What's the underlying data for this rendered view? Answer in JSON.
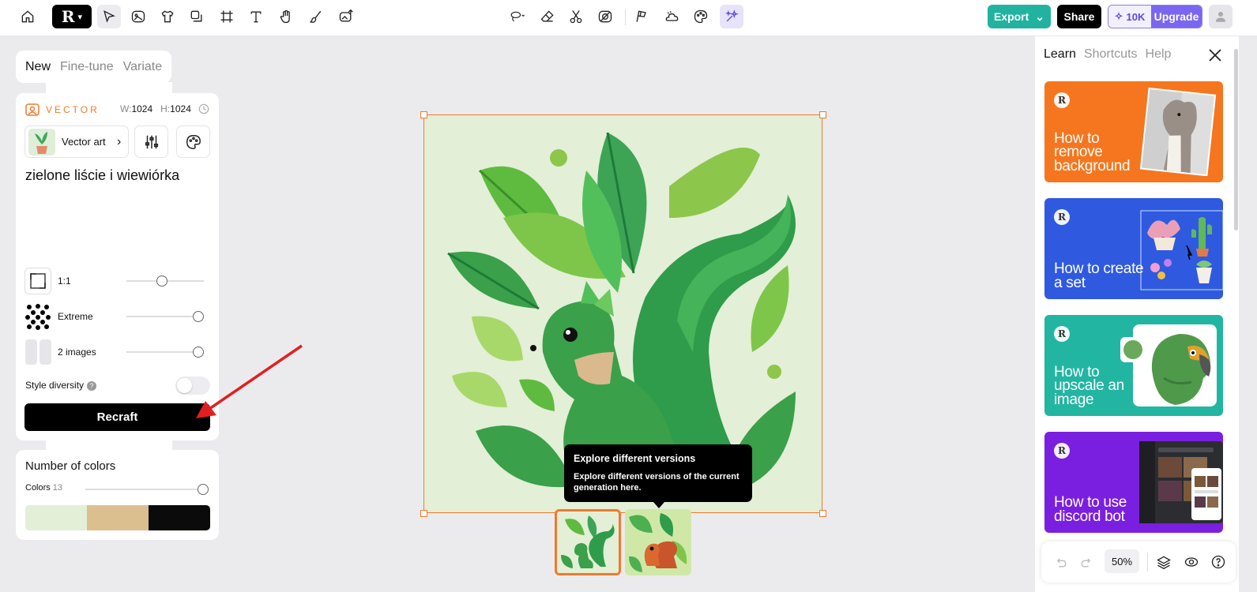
{
  "toolbar": {
    "tools": [
      "home-icon",
      "logo-menu",
      "select-icon",
      "image-generate-icon",
      "mockup-icon",
      "layers-copy-icon",
      "frame-icon",
      "text-icon",
      "hand-icon",
      "brush-icon",
      "image-upload-icon"
    ],
    "center_tools": [
      "lasso-icon",
      "eraser-icon",
      "scissors-icon",
      "vectorize-icon",
      "flags-icon",
      "cloud-icon",
      "palette-icon",
      "magic-sparkle-icon"
    ],
    "export_label": "Export",
    "share_label": "Share",
    "credits": "10K",
    "upgrade_label": "Upgrade"
  },
  "left": {
    "tabs": [
      {
        "label": "New",
        "active": true
      },
      {
        "label": "Fine-tune",
        "active": false
      },
      {
        "label": "Variate",
        "active": false
      }
    ],
    "vector_label": "VECTOR",
    "width_label": "W:",
    "width": "1024",
    "height_label": "H:",
    "height": "1024",
    "style_name": "Vector art",
    "prompt": "zielone liście i wiewiórka",
    "settings": [
      {
        "label": "1:1",
        "value": 0.45
      },
      {
        "label": "Extreme",
        "value": 0.92
      },
      {
        "label": "2 images",
        "value": 0.92
      }
    ],
    "style_diversity_label": "Style diversity",
    "style_diversity_on": false,
    "recraft_label": "Recraft",
    "colors": {
      "title": "Number of colors",
      "label": "Colors",
      "count": "13",
      "palette": [
        "#e3efd6",
        "#dcbf8f",
        "#0b0b0b"
      ]
    }
  },
  "canvas": {
    "tooltip_title": "Explore different versions",
    "tooltip_body": "Explore different versions of the current generation here."
  },
  "right": {
    "tabs": [
      {
        "label": "Learn",
        "active": true
      },
      {
        "label": "Shortcuts",
        "active": false
      },
      {
        "label": "Help",
        "active": false
      }
    ],
    "cards": [
      {
        "title": "How to remove background",
        "color": "#f5761f"
      },
      {
        "title": "How to create a set",
        "color": "#2f5ae0"
      },
      {
        "title": "How to upscale an image",
        "color": "#22b5a2"
      },
      {
        "title": "How to use discord bot",
        "color": "#7a1fe0"
      }
    ],
    "zoom": "50%"
  }
}
